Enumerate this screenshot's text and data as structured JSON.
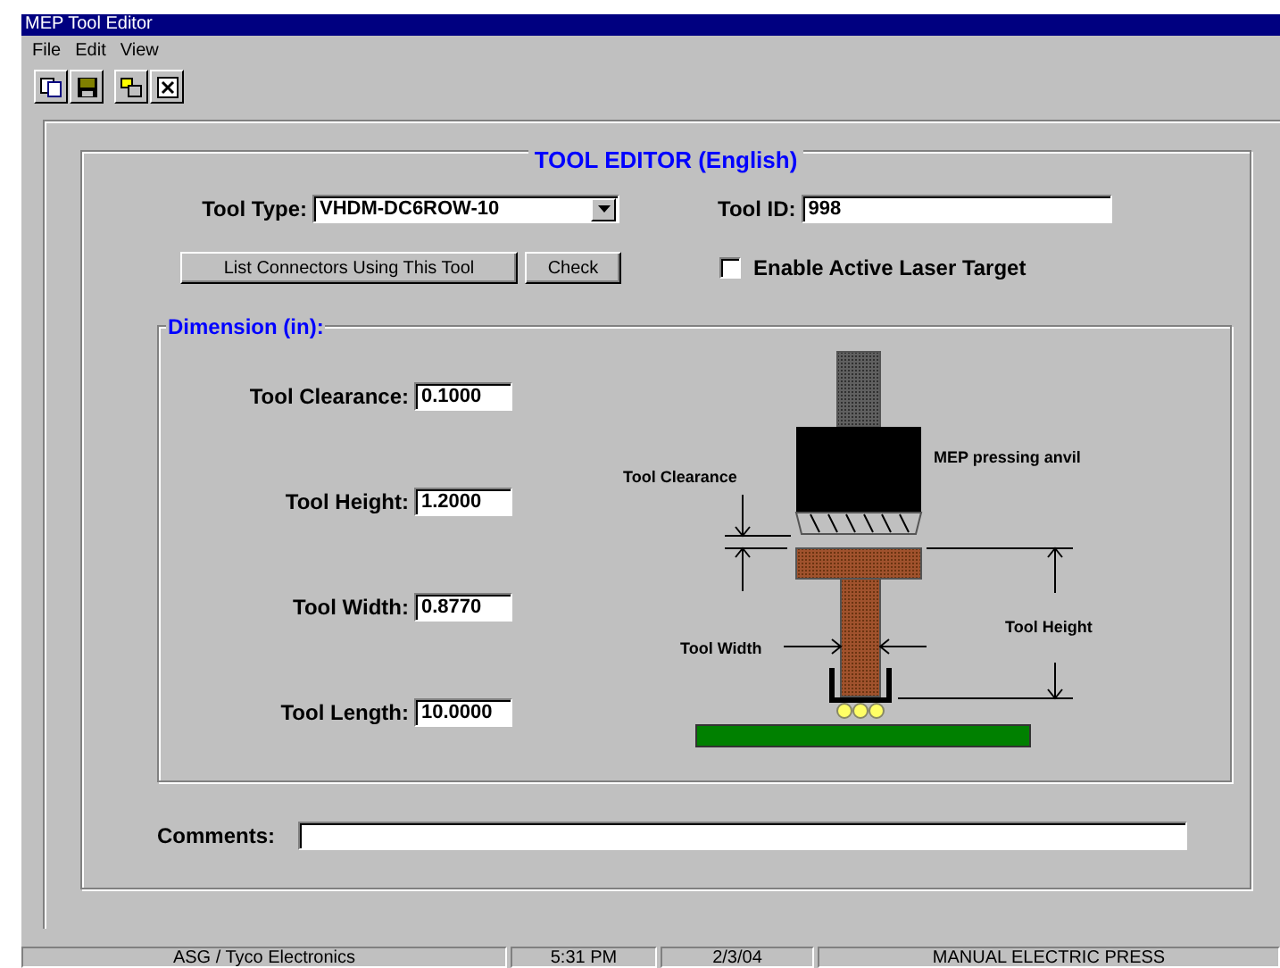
{
  "window": {
    "title": "MEP Tool Editor"
  },
  "menu": [
    "File",
    "Edit",
    "View"
  ],
  "form": {
    "heading": "TOOL EDITOR (English)",
    "tool_type": {
      "label": "Tool Type:",
      "value": "VHDM-DC6ROW-10"
    },
    "tool_id": {
      "label": "Tool ID:",
      "value": "998"
    },
    "buttons": [
      "List Connectors Using This Tool",
      "Check"
    ],
    "laser": {
      "label": "Enable Active Laser Target",
      "checked": false
    }
  },
  "dimensions": {
    "title": "Dimension (in):",
    "fields": [
      {
        "label": "Tool Clearance:",
        "value": "0.1000"
      },
      {
        "label": "Tool Height:",
        "value": "1.2000"
      },
      {
        "label": "Tool Width:",
        "value": "0.8770"
      },
      {
        "label": "Tool Length:",
        "value": "10.0000"
      }
    ]
  },
  "diagram": {
    "anvil": "MEP pressing anvil",
    "clearance": "Tool Clearance",
    "width": "Tool Width",
    "height": "Tool Height"
  },
  "comments": {
    "label": "Comments:"
  },
  "status_bar": [
    "ASG / Tyco Electronics",
    "5:31 PM",
    "2/3/04",
    "MANUAL ELECTRIC PRESS"
  ]
}
